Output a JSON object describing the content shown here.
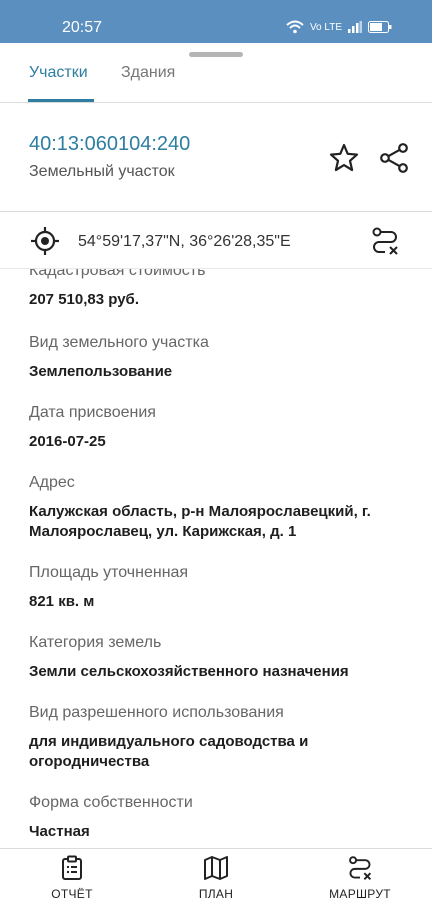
{
  "status_bar": {
    "time": "20:57",
    "network_label": "Vo LTE",
    "battery_label": ""
  },
  "tabs": [
    {
      "label": "Участки",
      "active": true
    },
    {
      "label": "Здания",
      "active": false
    }
  ],
  "parcel": {
    "cadastral_number": "40:13:060104:240",
    "type": "Земельный участок"
  },
  "coordinates": {
    "text": "54°59'17,37\"N, 36°26'28,35\"E"
  },
  "fields": [
    {
      "label": "Кадастровая стоимость",
      "value": "207 510,83 руб."
    },
    {
      "label": "Вид земельного участка",
      "value": "Землепользование"
    },
    {
      "label": "Дата присвоения",
      "value": "2016-07-25"
    },
    {
      "label": "Адрес",
      "value": "Калужская область, р-н Малоярославецкий, г. Малоярославец, ул. Карижская, д. 1"
    },
    {
      "label": "Площадь уточненная",
      "value": "821 кв. м"
    },
    {
      "label": "Категория земель",
      "value": "Земли сельскохозяйственного назначения"
    },
    {
      "label": "Вид разрешенного использования",
      "value": "для индивидуального садоводства и огородничества"
    },
    {
      "label": "Форма собственности",
      "value": "Частная"
    }
  ],
  "bottom_nav": [
    {
      "label": "ОТЧЁТ",
      "icon": "clipboard-icon"
    },
    {
      "label": "ПЛАН",
      "icon": "map-icon"
    },
    {
      "label": "МАРШРУТ",
      "icon": "route-icon"
    }
  ],
  "colors": {
    "accent": "#2d7ea0",
    "status_bar": "#5a8fc0"
  }
}
